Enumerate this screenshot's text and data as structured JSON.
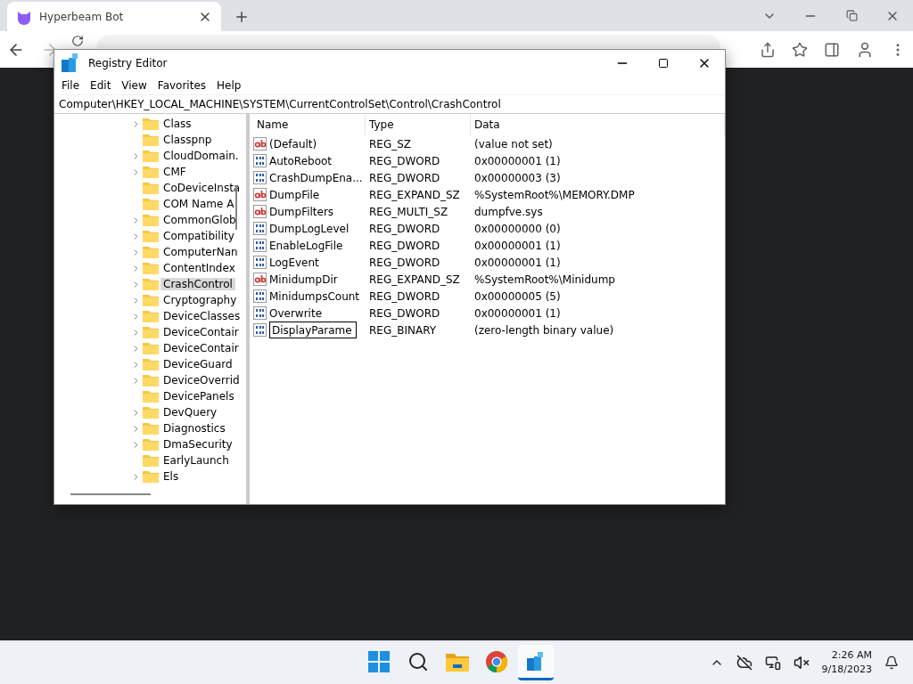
{
  "browser": {
    "tab": {
      "title": "Hyperbeam Bot"
    }
  },
  "window": {
    "title": "Registry Editor",
    "menu": [
      "File",
      "Edit",
      "View",
      "Favorites",
      "Help"
    ],
    "address": "Computer\\HKEY_LOCAL_MACHINE\\SYSTEM\\CurrentControlSet\\Control\\CrashControl"
  },
  "tree": {
    "items": [
      {
        "label": "Class",
        "expandable": true,
        "selected": false
      },
      {
        "label": "Classpnp",
        "expandable": false,
        "selected": false
      },
      {
        "label": "CloudDomain.",
        "expandable": true,
        "selected": false
      },
      {
        "label": "CMF",
        "expandable": true,
        "selected": false
      },
      {
        "label": "CoDeviceInsta",
        "expandable": false,
        "selected": false
      },
      {
        "label": "COM Name A",
        "expandable": false,
        "selected": false
      },
      {
        "label": "CommonGlob",
        "expandable": true,
        "selected": false
      },
      {
        "label": "Compatibility",
        "expandable": true,
        "selected": false
      },
      {
        "label": "ComputerNan",
        "expandable": true,
        "selected": false
      },
      {
        "label": "ContentIndex",
        "expandable": true,
        "selected": false
      },
      {
        "label": "CrashControl",
        "expandable": true,
        "selected": true
      },
      {
        "label": "Cryptography",
        "expandable": true,
        "selected": false
      },
      {
        "label": "DeviceClasses",
        "expandable": true,
        "selected": false
      },
      {
        "label": "DeviceContair",
        "expandable": true,
        "selected": false
      },
      {
        "label": "DeviceContair",
        "expandable": true,
        "selected": false
      },
      {
        "label": "DeviceGuard",
        "expandable": true,
        "selected": false
      },
      {
        "label": "DeviceOverrid",
        "expandable": true,
        "selected": false
      },
      {
        "label": "DevicePanels",
        "expandable": false,
        "selected": false
      },
      {
        "label": "DevQuery",
        "expandable": true,
        "selected": false
      },
      {
        "label": "Diagnostics",
        "expandable": true,
        "selected": false
      },
      {
        "label": "DmaSecurity",
        "expandable": true,
        "selected": false
      },
      {
        "label": "EarlyLaunch",
        "expandable": false,
        "selected": false
      },
      {
        "label": "Els",
        "expandable": true,
        "selected": false
      }
    ]
  },
  "values": {
    "columns": [
      "Name",
      "Type",
      "Data"
    ],
    "rows": [
      {
        "kind": "string",
        "name": "(Default)",
        "type": "REG_SZ",
        "data": "(value not set)",
        "editing": false
      },
      {
        "kind": "binary",
        "name": "AutoReboot",
        "type": "REG_DWORD",
        "data": "0x00000001 (1)",
        "editing": false
      },
      {
        "kind": "binary",
        "name": "CrashDumpEna...",
        "type": "REG_DWORD",
        "data": "0x00000003 (3)",
        "editing": false
      },
      {
        "kind": "string",
        "name": "DumpFile",
        "type": "REG_EXPAND_SZ",
        "data": "%SystemRoot%\\MEMORY.DMP",
        "editing": false
      },
      {
        "kind": "string",
        "name": "DumpFilters",
        "type": "REG_MULTI_SZ",
        "data": "dumpfve.sys",
        "editing": false
      },
      {
        "kind": "binary",
        "name": "DumpLogLevel",
        "type": "REG_DWORD",
        "data": "0x00000000 (0)",
        "editing": false
      },
      {
        "kind": "binary",
        "name": "EnableLogFile",
        "type": "REG_DWORD",
        "data": "0x00000001 (1)",
        "editing": false
      },
      {
        "kind": "binary",
        "name": "LogEvent",
        "type": "REG_DWORD",
        "data": "0x00000001 (1)",
        "editing": false
      },
      {
        "kind": "string",
        "name": "MinidumpDir",
        "type": "REG_EXPAND_SZ",
        "data": "%SystemRoot%\\Minidump",
        "editing": false
      },
      {
        "kind": "binary",
        "name": "MinidumpsCount",
        "type": "REG_DWORD",
        "data": "0x00000005 (5)",
        "editing": false
      },
      {
        "kind": "binary",
        "name": "Overwrite",
        "type": "REG_DWORD",
        "data": "0x00000001 (1)",
        "editing": false
      },
      {
        "kind": "binary",
        "name": "DisplayParame",
        "type": "REG_BINARY",
        "data": "(zero-length binary value)",
        "editing": true
      }
    ]
  },
  "taskbar": {
    "apps": [
      {
        "kind": "start",
        "selected": false
      },
      {
        "kind": "search",
        "selected": false
      },
      {
        "kind": "explorer",
        "selected": false
      },
      {
        "kind": "chrome",
        "selected": false
      },
      {
        "kind": "regedit",
        "selected": true
      }
    ],
    "time": "2:26 AM",
    "date": "9/18/2023"
  }
}
